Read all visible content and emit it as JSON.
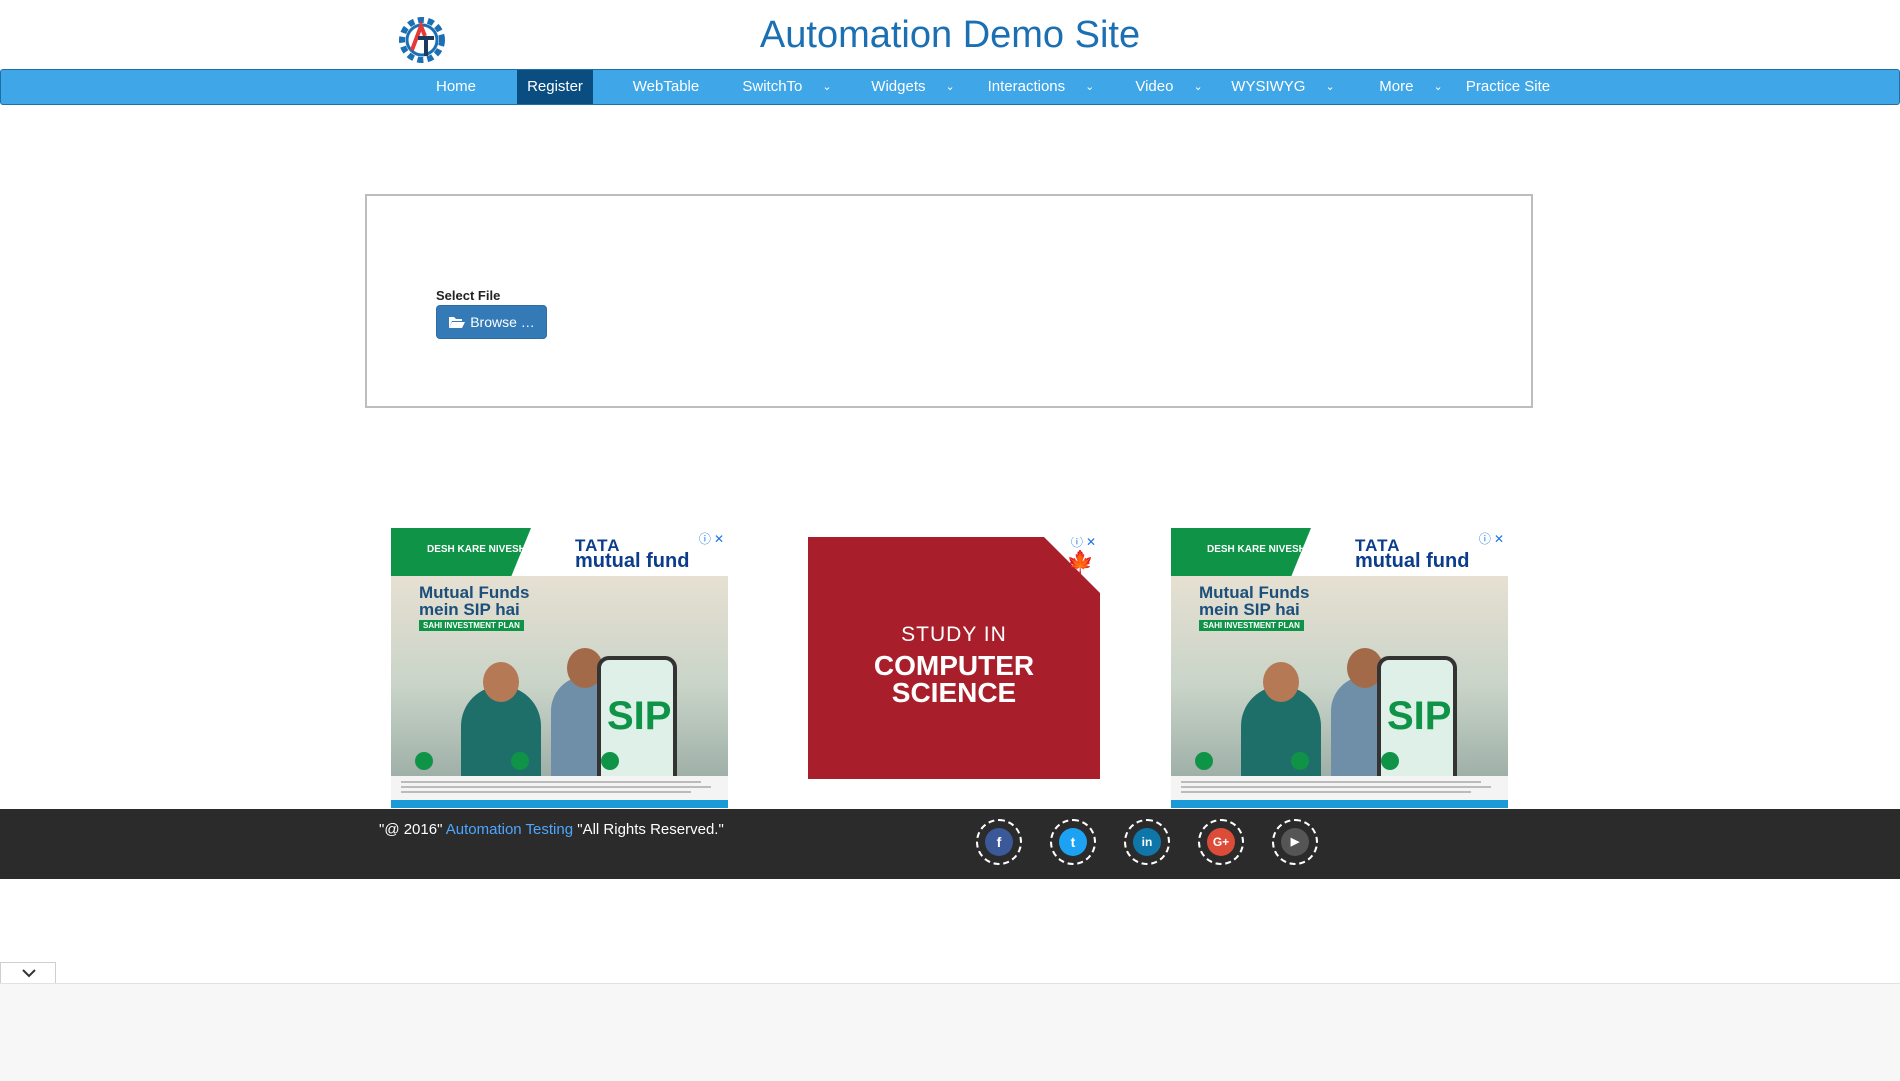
{
  "header": {
    "logo_text": "AT",
    "title": "Automation Demo Site"
  },
  "nav": {
    "items": [
      {
        "label": "Home"
      },
      {
        "label": "Register"
      },
      {
        "label": "WebTable"
      },
      {
        "label": "SwitchTo"
      },
      {
        "label": "Widgets"
      },
      {
        "label": "Interactions"
      },
      {
        "label": "Video"
      },
      {
        "label": "WYSIWYG"
      },
      {
        "label": "More"
      },
      {
        "label": "Practice Site"
      }
    ]
  },
  "upload": {
    "label": "Select File",
    "browse_label": "Browse …"
  },
  "ads": {
    "sip": {
      "tag": "DESH KARE NIVESH",
      "brand_line1": "TATA",
      "brand_line2": "mutual fund",
      "headline_line1": "Mutual Funds",
      "headline_line2": "mein SIP hai",
      "subline": "SAHI INVESTMENT PLAN",
      "phone_text": "SIP",
      "adchoice_icon": "ⓘ",
      "close_icon": "✕"
    },
    "study": {
      "line1": "STUDY IN",
      "line2": "COMPUTER",
      "line3": "SCIENCE",
      "adchoice_icon": "ⓘ",
      "close_icon": "✕",
      "leaf_icon": "🍁"
    }
  },
  "footer": {
    "copy_prefix": "\"@ 2016\"",
    "copy_link": "Automation Testing",
    "copy_suffix": "\"All Rights Reserved.\"",
    "social": [
      {
        "name": "facebook-icon",
        "glyph": "f",
        "color": "#3b5998"
      },
      {
        "name": "twitter-icon",
        "glyph": "t",
        "color": "#1da1f2"
      },
      {
        "name": "linkedin-icon",
        "glyph": "in",
        "color": "#0e76a8"
      },
      {
        "name": "google-plus-icon",
        "glyph": "G+",
        "color": "#dd4b39"
      },
      {
        "name": "youtube-icon",
        "glyph": "▶",
        "color": "#555555"
      }
    ]
  },
  "colors": {
    "nav_bg": "#3fa6e8",
    "nav_active": "#0a4d80",
    "title": "#1b6fb3",
    "button": "#337ab7",
    "footer_bg": "#2b2b2b"
  }
}
